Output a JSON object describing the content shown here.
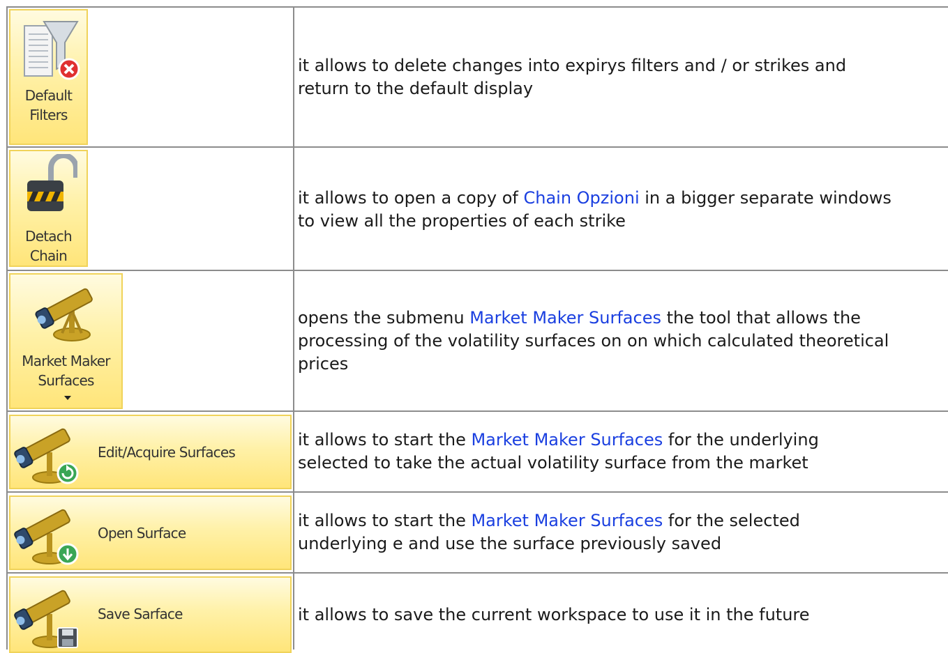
{
  "rows": [
    {
      "button": {
        "label_lines": [
          "Default",
          "Filters"
        ],
        "icon": "default-filters-icon"
      },
      "description": {
        "text": "it allows to delete changes into expirys filters and / or strikes and return to the default display"
      }
    },
    {
      "button": {
        "label_lines": [
          "Detach",
          "Chain"
        ],
        "icon": "padlock-open-icon"
      },
      "description": {
        "before_link": "it allows to open a copy of ",
        "link": "Chain Opzioni",
        "after_link": " in a bigger separate windows to view all the properties of each strike"
      }
    },
    {
      "button": {
        "label_lines": [
          "Market Maker",
          "Surfaces"
        ],
        "icon": "telescope-icon",
        "has_dropdown": true
      },
      "description": {
        "before_link": "opens the submenu ",
        "link": "Market Maker Surfaces",
        "after_link": " the tool that allows the processing of the volatility surfaces on on which calculated theoretical prices"
      }
    },
    {
      "button": {
        "label": "Edit/Acquire Surfaces",
        "icon": "telescope-refresh-icon"
      },
      "description": {
        "before_link": "it allows to start the ",
        "link": "Market Maker Surfaces",
        "after_link": " for the underlying selected to take the actual volatility surface from the market"
      }
    },
    {
      "button": {
        "label": "Open Surface",
        "icon": "telescope-download-icon"
      },
      "description": {
        "before_link": "it allows to start the ",
        "link": "Market Maker Surfaces",
        "after_link": " for the selected underlying e and use the surface previously saved"
      }
    },
    {
      "button": {
        "label": "Save Sarface",
        "icon": "telescope-save-icon"
      },
      "description": {
        "text": "it allows to save the current workspace to use it in the future"
      }
    }
  ],
  "colors": {
    "link": "#1a3fe0",
    "button_border": "#f0d35a",
    "grid": "#8c8c8c"
  }
}
